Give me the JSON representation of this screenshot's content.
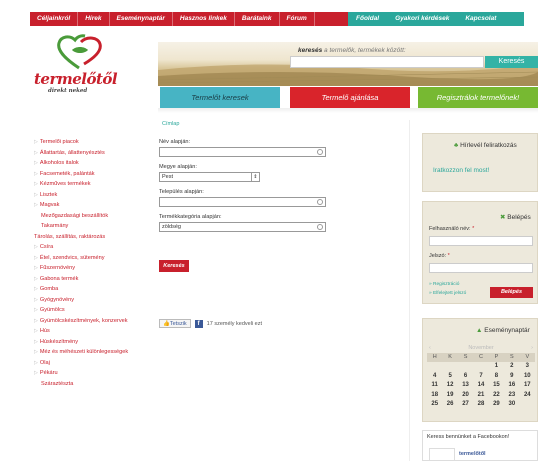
{
  "topnav": {
    "red_items": [
      "Céljainkról",
      "Hírek",
      "Eseménynaptár",
      "Hasznos linkek",
      "Barátaink",
      "Fórum"
    ],
    "teal_items": [
      "Főoldal",
      "Gyakori kérdések",
      "Kapcsolat"
    ]
  },
  "logo": {
    "name": "termelőtől",
    "tagline": "direkt neked"
  },
  "search": {
    "label_bold": "keresés",
    "label_rest": " a termelők, termékek között:",
    "button": "Keresés"
  },
  "bigbuttons": [
    "Termelőt keresek",
    "Termelő ajánlása",
    "Regisztrálok termelőnek!"
  ],
  "sidebar": {
    "items": [
      {
        "label": "Termelői piacok",
        "arrow": true
      },
      {
        "label": "Állattartás, állattenyésztés",
        "arrow": true
      },
      {
        "label": "Alkoholos italok",
        "arrow": true
      },
      {
        "label": "Facsemeték, palánták",
        "arrow": true
      },
      {
        "label": "Kézműves termékek",
        "arrow": true
      },
      {
        "label": "Lisztek",
        "arrow": true
      },
      {
        "label": "Magvak",
        "arrow": true
      },
      {
        "label": "Mezőgazdasági beszállítók",
        "arrow": false
      },
      {
        "label": "Takarmány",
        "arrow": false
      },
      {
        "label": "Tárolás, szállítás, raktározás",
        "arrow": false
      },
      {
        "label": "Csíra",
        "arrow": true
      },
      {
        "label": "Étel, szendvics, sütemény",
        "arrow": true
      },
      {
        "label": "Fűszernövény",
        "arrow": true
      },
      {
        "label": "Gabona termék",
        "arrow": true
      },
      {
        "label": "Gomba",
        "arrow": true
      },
      {
        "label": "Gyógynövény",
        "arrow": true
      },
      {
        "label": "Gyümölcs",
        "arrow": true
      },
      {
        "label": "Gyümölcskészítmények, konzervek",
        "arrow": true
      },
      {
        "label": "Hús",
        "arrow": true
      },
      {
        "label": "Húskészítmény",
        "arrow": true
      },
      {
        "label": "Méz és méhészeti különlegességek",
        "arrow": true
      },
      {
        "label": "Olaj",
        "arrow": true
      },
      {
        "label": "Pékáru",
        "arrow": true
      },
      {
        "label": "Száraztészta",
        "arrow": false
      }
    ]
  },
  "breadcrumb": "Címlap",
  "form": {
    "name_label": "Név alapján:",
    "name_value": "",
    "county_label": "Megye alapján:",
    "county_value": "Pest",
    "town_label": "Település alapján:",
    "town_value": "",
    "category_label": "Termékkategória alapján:",
    "category_value": "zöldség",
    "submit": "Keresés"
  },
  "like": {
    "button": "Tetszik",
    "text": "17 személy kedveli ezt"
  },
  "newsletter": {
    "title": "Hírlevél feliratkozás",
    "link": "Iratkozzon fel most!"
  },
  "login": {
    "title": "Belépés",
    "user_label": "Felhasználó név:",
    "pass_label": "Jelszó:",
    "register": "Regisztráció",
    "forgot": "Elfelejtett jelszó",
    "button": "Belépés"
  },
  "calendar": {
    "title": "Eseménynaptár",
    "month": "November",
    "prev": "‹",
    "next": "›",
    "days": [
      "H",
      "K",
      "S",
      "C",
      "P",
      "S",
      "V"
    ],
    "weeks": [
      [
        "",
        "",
        "",
        "",
        "1",
        "2",
        "3"
      ],
      [
        "4",
        "5",
        "6",
        "7",
        "8",
        "9",
        "10"
      ],
      [
        "11",
        "12",
        "13",
        "14",
        "15",
        "16",
        "17"
      ],
      [
        "18",
        "19",
        "20",
        "21",
        "22",
        "23",
        "24"
      ],
      [
        "25",
        "26",
        "27",
        "28",
        "29",
        "30",
        ""
      ]
    ]
  },
  "facebook": {
    "title": "Keress bennünket a Facebookon!",
    "page": "termelőtől"
  }
}
